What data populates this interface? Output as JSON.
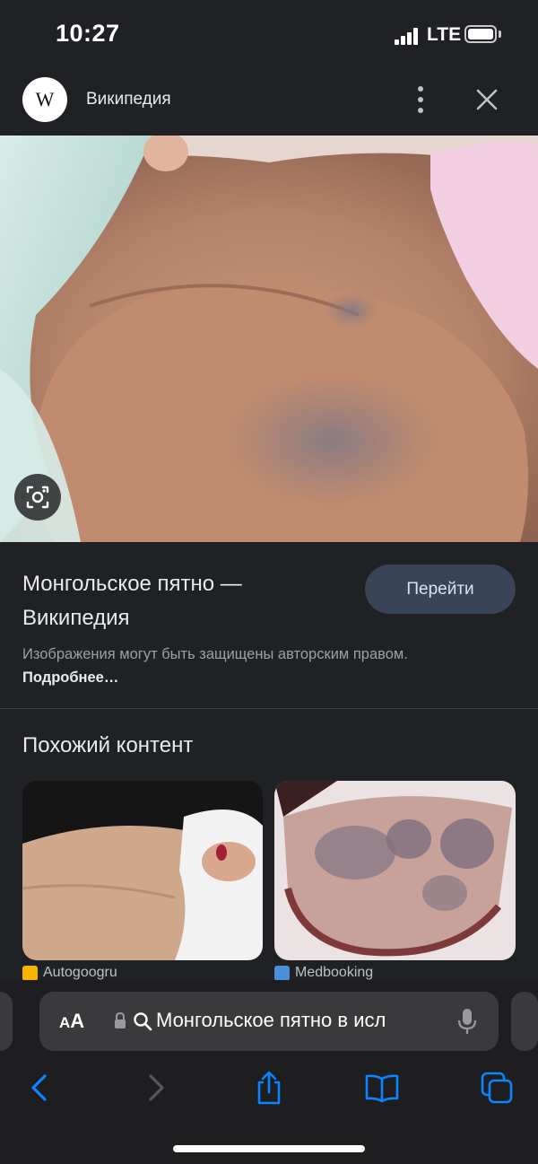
{
  "status_bar": {
    "time": "10:27",
    "network": "LTE"
  },
  "header": {
    "logo_letter": "W",
    "site_name": "Википедия"
  },
  "result": {
    "title": "Монгольское пятно — Википедия",
    "visit_label": "Перейти",
    "copyright_text": "Изображения могут быть защищены авторским правом.",
    "more_link": "Подробнее…"
  },
  "related": {
    "heading": "Похожий контент",
    "items": [
      {
        "source": "Autogoogru",
        "favicon_color": "#f4b400"
      },
      {
        "source": "Medbooking",
        "favicon_color": "#4a90d9"
      }
    ]
  },
  "address_bar": {
    "text_size_label_small": "A",
    "text_size_label_big": "A",
    "query": "Монгольское пятно в исл"
  },
  "colors": {
    "accent": "#0a84ff",
    "visit_button_bg": "#394457"
  }
}
